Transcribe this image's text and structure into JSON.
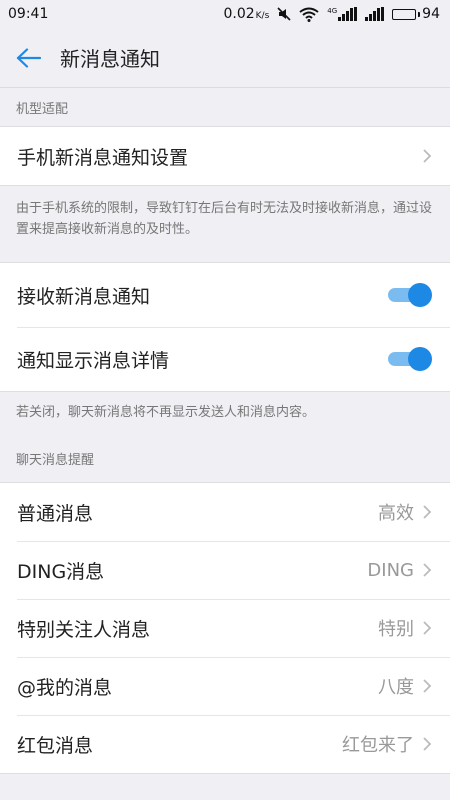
{
  "status_bar": {
    "time": "09:41",
    "net_speed": "0.02",
    "net_unit": "K/s",
    "signal_tag": "4G",
    "battery_level": "94",
    "battery_fraction": 0.94
  },
  "nav": {
    "back_icon": "arrow-left-icon",
    "title": "新消息通知"
  },
  "section_device": {
    "header": "机型适配",
    "row_label": "手机新消息通知设置",
    "note": "由于手机系统的限制，导致钉钉在后台有时无法及时接收新消息，通过设置来提高接收新消息的及时性。"
  },
  "section_toggles": {
    "rows": [
      {
        "label": "接收新消息通知",
        "on": true
      },
      {
        "label": "通知显示消息详情",
        "on": true
      }
    ],
    "note": "若关闭，聊天新消息将不再显示发送人和消息内容。"
  },
  "section_chat": {
    "header": "聊天消息提醒",
    "rows": [
      {
        "label": "普通消息",
        "value": "高效"
      },
      {
        "label": "DING消息",
        "value": "DING"
      },
      {
        "label": "特别关注人消息",
        "value": "特别"
      },
      {
        "label": "@我的消息",
        "value": "八度"
      },
      {
        "label": "红包消息",
        "value": "红包来了"
      }
    ]
  },
  "colors": {
    "accent": "#1e88e5",
    "toggle_track": "#7bbcf0",
    "background": "#efeff4"
  }
}
